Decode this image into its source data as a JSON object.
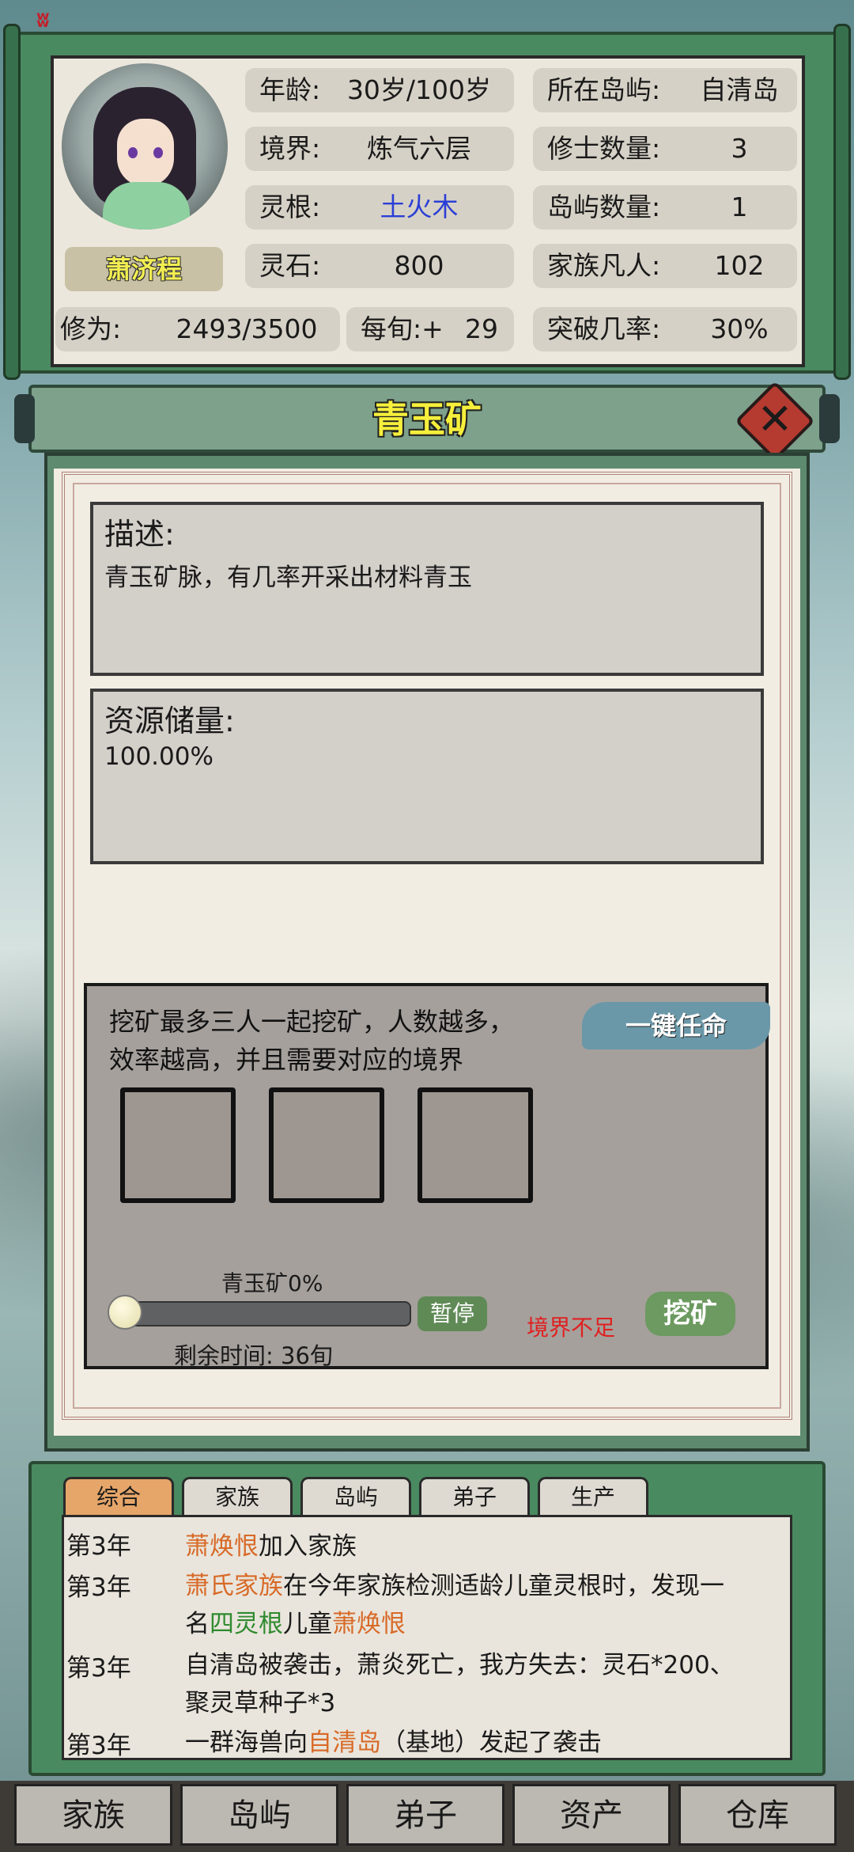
{
  "status_bar": {
    "glyph": "ʬ"
  },
  "profile": {
    "name": "萧济程",
    "age_label": "年龄:",
    "age_value": "30岁/100岁",
    "realm_label": "境界:",
    "realm_value": "炼气六层",
    "root_label": "灵根:",
    "root_value": "土火木",
    "stone_label": "灵石:",
    "stone_value": "800",
    "cult_label": "修为:",
    "cult_value": "2493/3500",
    "per_turn_label": "每旬:+",
    "per_turn_value": "29",
    "island_label": "所在岛屿:",
    "island_value": "自清岛",
    "cultivators_label": "修士数量:",
    "cultivators_value": "3",
    "islands_label": "岛屿数量:",
    "islands_value": "1",
    "mortals_label": "家族凡人:",
    "mortals_value": "102",
    "breakthrough_label": "突破几率:",
    "breakthrough_value": "30%"
  },
  "dialog": {
    "title": "青玉矿",
    "close_symbol": "✕",
    "desc_title": "描述:",
    "desc_text": "青玉矿脉，有几率开采出材料青玉",
    "reserve_title": "资源储量:",
    "reserve_value": "100.00%",
    "mining_desc_line1": "挖矿最多三人一起挖矿，人数越多，",
    "mining_desc_line2": "效率越高，并且需要对应的境界",
    "assign_button": "一键任命",
    "progress_label": "青玉矿0%",
    "progress_value": 0,
    "pause_button": "暂停",
    "remaining_time": "剩余时间: 36旬",
    "realm_warning": "境界不足",
    "mine_button": "挖矿"
  },
  "log": {
    "tabs": [
      "综合",
      "家族",
      "岛屿",
      "弟子",
      "生产"
    ],
    "entries": [
      {
        "year": "第3年",
        "p1": "萧焕恨",
        "p2": "加入家族"
      },
      {
        "year": "第3年",
        "p1": "萧氏家族",
        "p2": "在今年家族检测适龄儿童灵根时，发现一",
        "p3": "名",
        "p4": "四灵根",
        "p5": "儿童",
        "p6": "萧焕恨"
      },
      {
        "year": "第3年",
        "p1": "自清岛被袭击，萧炎死亡，我方失去：灵石*200、",
        "p2": "聚灵草种子*3"
      },
      {
        "year": "第3年",
        "p1": "一群海兽向",
        "p2": "自清岛",
        "p3": "（基地）发起了袭击"
      }
    ]
  },
  "nav": [
    "家族",
    "岛屿",
    "弟子",
    "资产",
    "仓库"
  ],
  "colors": {
    "title": "#f6ef3c",
    "root_value": "#2b3fd6",
    "highlight_orange": "#d86a28",
    "highlight_green": "#2f8a2f",
    "warning": "#e02020"
  }
}
